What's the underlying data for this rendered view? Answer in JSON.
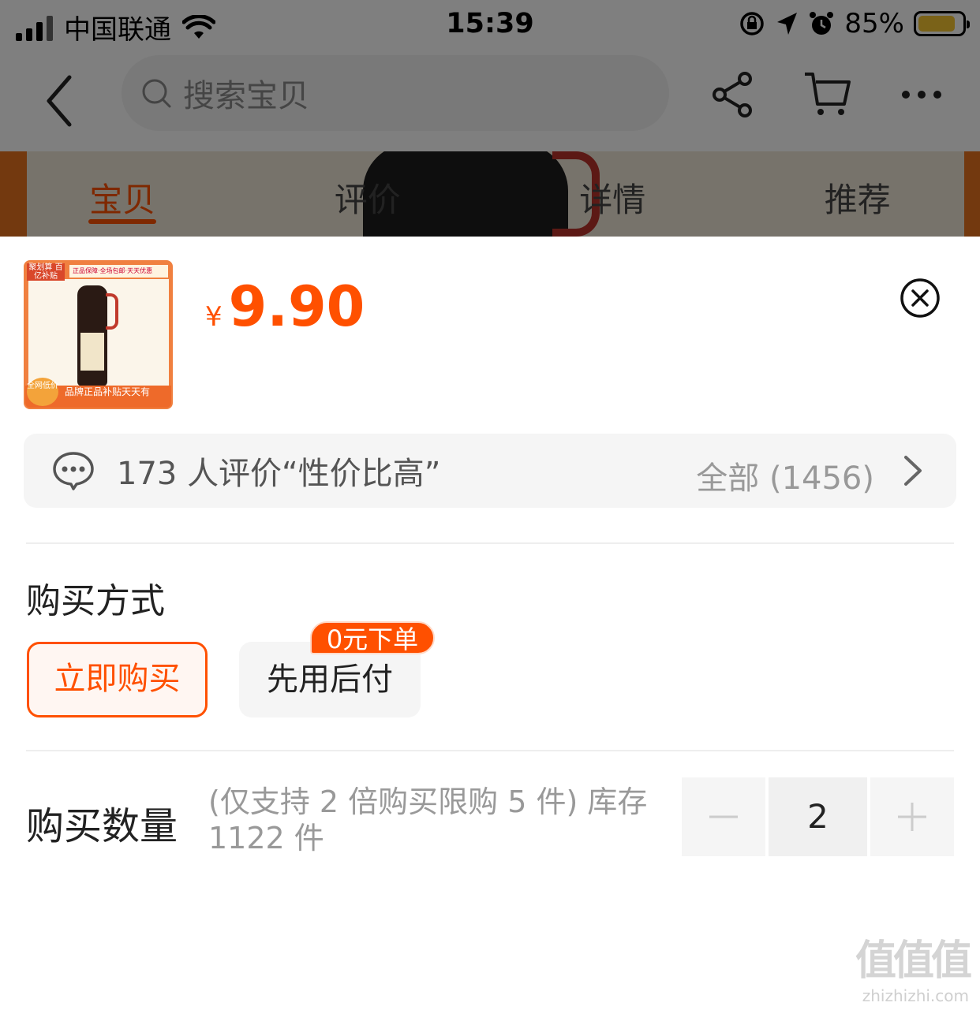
{
  "status_bar": {
    "carrier": "中国联通",
    "time": "15:39",
    "battery_percent": "85%",
    "battery_level": 0.85
  },
  "nav": {
    "search_placeholder": "搜索宝贝"
  },
  "tabs": [
    {
      "label": "宝贝",
      "active": true
    },
    {
      "label": "评价",
      "active": false
    },
    {
      "label": "详情",
      "active": false
    },
    {
      "label": "推荐",
      "active": false
    }
  ],
  "product": {
    "currency": "¥",
    "price": "9.90",
    "thumbnail": {
      "tag_top_left": "聚划算 百亿补贴",
      "tag_top": "正品保障·全场包邮·天天优惠",
      "bottom_text": "品牌正品补贴天天有",
      "low_price_badge": "全网低价"
    }
  },
  "reviews": {
    "summary": "173 人评价“性价比高”",
    "all_label": "全部 (1456)"
  },
  "purchase_method": {
    "title": "购买方式",
    "options": [
      {
        "label": "立即购买",
        "selected": true
      },
      {
        "label": "先用后付",
        "selected": false
      }
    ],
    "badge": "0元下单"
  },
  "quantity": {
    "title": "购买数量",
    "note": "(仅支持 2 倍购买限购 5 件) 库存 1122 件",
    "value": "2"
  },
  "watermark": {
    "logo": "值值值",
    "url": "zhizhizhi.com"
  },
  "colors": {
    "accent": "#ff5000",
    "text_dark": "#222222",
    "text_muted": "#999999",
    "panel_bg": "#f5f5f5"
  }
}
